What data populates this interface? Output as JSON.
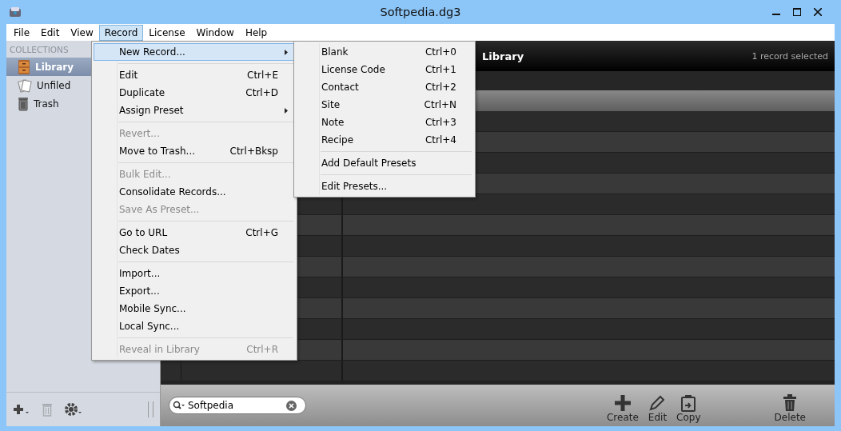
{
  "window": {
    "title": "Softpedia.dg3"
  },
  "menubar": [
    {
      "label": "File",
      "selected": false
    },
    {
      "label": "Edit",
      "selected": false
    },
    {
      "label": "View",
      "selected": false
    },
    {
      "label": "Record",
      "selected": true
    },
    {
      "label": "License",
      "selected": false
    },
    {
      "label": "Window",
      "selected": false
    },
    {
      "label": "Help",
      "selected": false
    }
  ],
  "sidebar": {
    "heading": "COLLECTIONS",
    "items": [
      {
        "label": "Library",
        "kind": "library",
        "selected": true
      },
      {
        "label": "Unfiled",
        "kind": "unfiled",
        "selected": false
      },
      {
        "label": "Trash",
        "kind": "trash",
        "selected": false
      }
    ],
    "toolbar": {
      "remove_disabled": true
    }
  },
  "header": {
    "title": "Library",
    "status": "1 record selected"
  },
  "record_menu": [
    {
      "kind": "item",
      "label": "New Record...",
      "selected": true,
      "disabled": false,
      "submenu": true
    },
    {
      "kind": "separator"
    },
    {
      "kind": "item",
      "label": "Edit",
      "shortcut": "Ctrl+E",
      "selected": false,
      "disabled": false,
      "submenu": false
    },
    {
      "kind": "item",
      "label": "Duplicate",
      "shortcut": "Ctrl+D",
      "selected": false,
      "disabled": false,
      "submenu": false
    },
    {
      "kind": "item",
      "label": "Assign Preset",
      "selected": false,
      "disabled": false,
      "submenu": true
    },
    {
      "kind": "separator"
    },
    {
      "kind": "item",
      "label": "Revert...",
      "selected": false,
      "disabled": true,
      "submenu": false
    },
    {
      "kind": "item",
      "label": "Move to Trash...",
      "shortcut": "Ctrl+Bksp",
      "selected": false,
      "disabled": false,
      "submenu": false
    },
    {
      "kind": "separator"
    },
    {
      "kind": "item",
      "label": "Bulk Edit...",
      "selected": false,
      "disabled": true,
      "submenu": false
    },
    {
      "kind": "item",
      "label": "Consolidate Records...",
      "selected": false,
      "disabled": false,
      "submenu": false
    },
    {
      "kind": "item",
      "label": "Save As Preset...",
      "selected": false,
      "disabled": true,
      "submenu": false
    },
    {
      "kind": "separator"
    },
    {
      "kind": "item",
      "label": "Go to URL",
      "shortcut": "Ctrl+G",
      "selected": false,
      "disabled": false,
      "submenu": false
    },
    {
      "kind": "item",
      "label": "Check Dates",
      "selected": false,
      "disabled": false,
      "submenu": false
    },
    {
      "kind": "separator"
    },
    {
      "kind": "item",
      "label": "Import...",
      "selected": false,
      "disabled": false,
      "submenu": false
    },
    {
      "kind": "item",
      "label": "Export...",
      "selected": false,
      "disabled": false,
      "submenu": false
    },
    {
      "kind": "item",
      "label": "Mobile Sync...",
      "selected": false,
      "disabled": false,
      "submenu": false
    },
    {
      "kind": "item",
      "label": "Local Sync...",
      "selected": false,
      "disabled": false,
      "submenu": false
    },
    {
      "kind": "separator"
    },
    {
      "kind": "item",
      "label": "Reveal in Library",
      "shortcut": "Ctrl+R",
      "selected": false,
      "disabled": true,
      "submenu": false
    }
  ],
  "new_record_submenu": [
    {
      "kind": "item",
      "label": "Blank",
      "shortcut": "Ctrl+0",
      "selected": false,
      "disabled": false,
      "submenu": false
    },
    {
      "kind": "item",
      "label": "License Code",
      "shortcut": "Ctrl+1",
      "selected": false,
      "disabled": false,
      "submenu": false
    },
    {
      "kind": "item",
      "label": "Contact",
      "shortcut": "Ctrl+2",
      "selected": false,
      "disabled": false,
      "submenu": false
    },
    {
      "kind": "item",
      "label": "Site",
      "shortcut": "Ctrl+N",
      "selected": false,
      "disabled": false,
      "submenu": false
    },
    {
      "kind": "item",
      "label": "Note",
      "shortcut": "Ctrl+3",
      "selected": false,
      "disabled": false,
      "submenu": false
    },
    {
      "kind": "item",
      "label": "Recipe",
      "shortcut": "Ctrl+4",
      "selected": false,
      "disabled": false,
      "submenu": false
    },
    {
      "kind": "separator"
    },
    {
      "kind": "item",
      "label": "Add Default Presets",
      "selected": false,
      "disabled": false,
      "submenu": false
    },
    {
      "kind": "separator"
    },
    {
      "kind": "item",
      "label": "Edit Presets...",
      "selected": false,
      "disabled": false,
      "submenu": false
    }
  ],
  "search": {
    "value": "Softpedia"
  },
  "toolbar": [
    {
      "label": "Create",
      "kind": "create"
    },
    {
      "label": "Edit",
      "kind": "edit"
    },
    {
      "label": "Copy",
      "kind": "copy"
    },
    {
      "label": "Delete",
      "kind": "delete"
    }
  ]
}
